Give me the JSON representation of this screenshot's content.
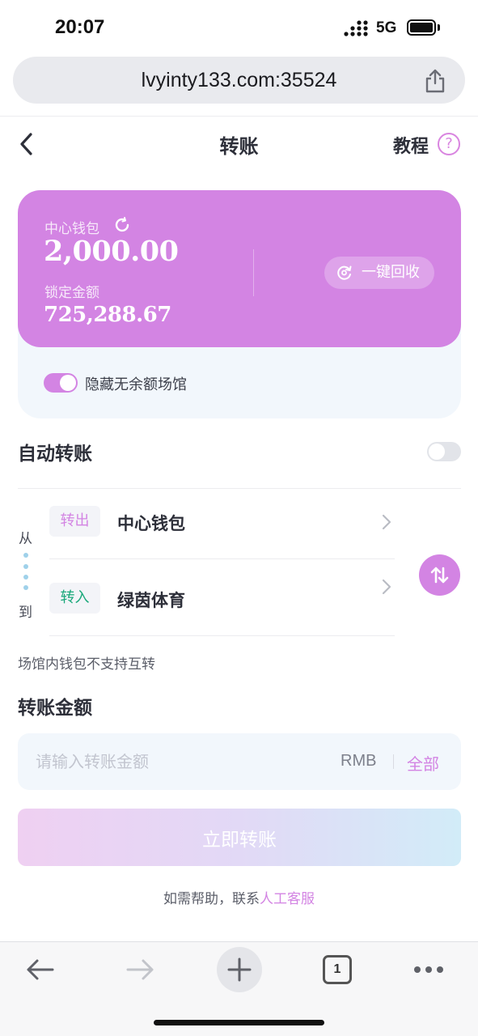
{
  "status_bar": {
    "time": "20:07",
    "network": "5G"
  },
  "browser": {
    "url": "lvyinty133.com:35524",
    "tab_count": "1"
  },
  "header": {
    "title": "转账",
    "tutorial": "教程",
    "help_glyph": "?"
  },
  "wallet_card": {
    "center_label": "中心钱包",
    "center_amount": "2,000.00",
    "locked_label": "锁定金额",
    "locked_amount": "725,288.67",
    "recycle_button": "一键回收",
    "hide_toggle_label": "隐藏无余额场馆",
    "hide_toggle_on": true
  },
  "auto_transfer": {
    "label": "自动转账",
    "enabled": false
  },
  "transfer": {
    "from_label": "从",
    "to_label": "到",
    "out_tag": "转出",
    "in_tag": "转入",
    "from_wallet": "中心钱包",
    "to_wallet": "绿茵体育",
    "note": "场馆内钱包不支持互转"
  },
  "amount": {
    "title": "转账金额",
    "placeholder": "请输入转账金额",
    "currency": "RMB",
    "all_label": "全部"
  },
  "submit_label": "立即转账",
  "help": {
    "text": "如需帮助，联系",
    "link": "人工客服"
  },
  "colors": {
    "accent": "#d384e3",
    "green": "#1aa87a",
    "card_bg": "#f2f7fc"
  },
  "icons": [
    "signal-icon",
    "battery-icon",
    "share-icon",
    "back-chevron-icon",
    "help-icon",
    "refresh-icon",
    "recycle-icon",
    "chevron-right-icon",
    "swap-icon",
    "nav-back-icon",
    "nav-forward-icon",
    "plus-icon",
    "tabs-icon",
    "more-icon"
  ]
}
